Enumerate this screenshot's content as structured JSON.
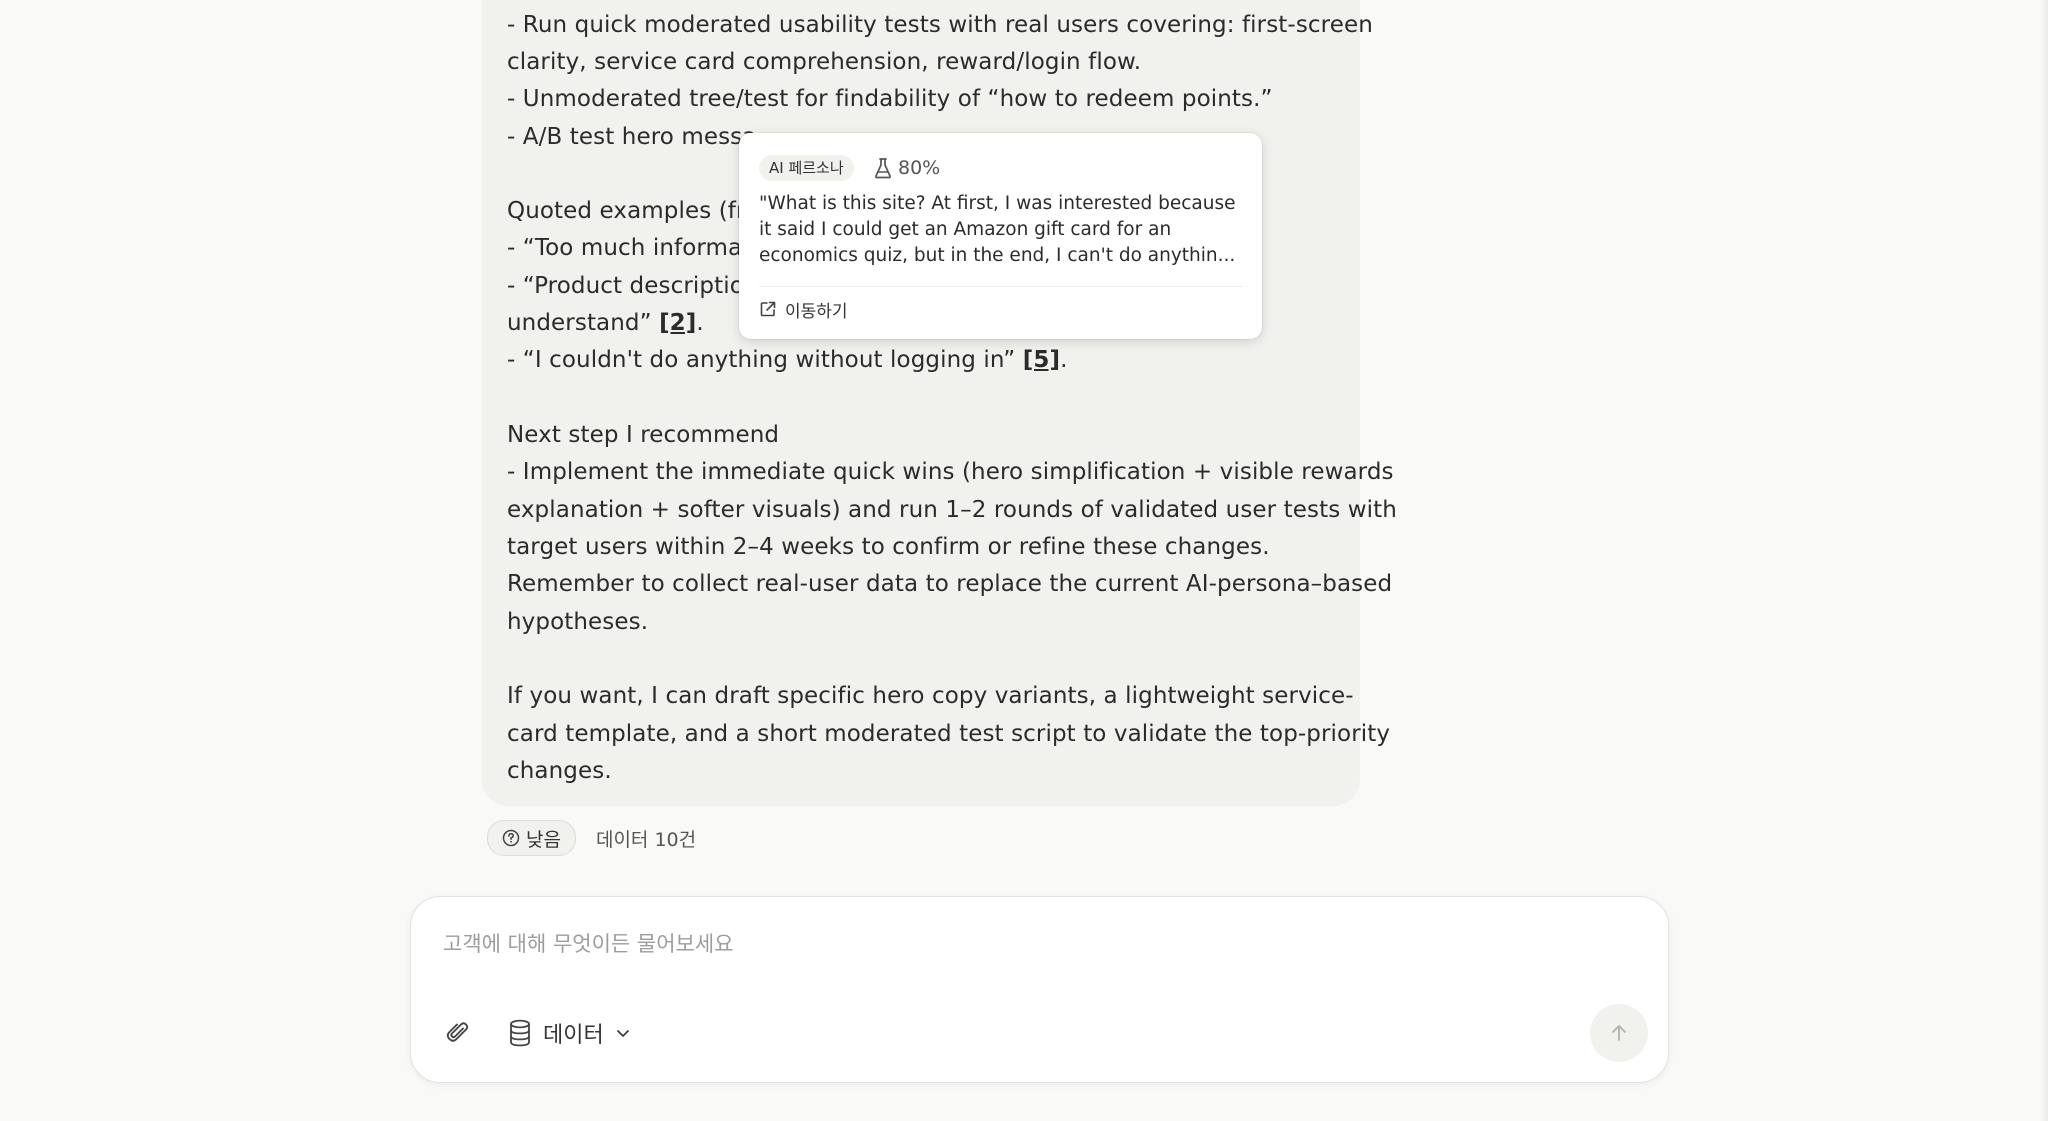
{
  "message": {
    "lines": [
      "- Run quick moderated usability tests with real users covering: first-screen",
      "clarity, service card comprehension, reward/login flow.",
      "- Unmoderated tree/test for findability of “how to redeem points.”",
      "- A/B test hero messa",
      "Quoted examples (fro",
      "- “Too much informat",
      "- “Product descriptio",
      "understand” ",
      "- “I couldn't do anything without logging in” ",
      "Next step I recommend",
      "- Implement the immediate quick wins (hero simplification + visible rewards",
      "explanation + softer visuals) and run 1–2 rounds of validated user tests with",
      "target users within 2–4 weeks to confirm or refine these changes.",
      "Remember to collect real-user data to replace the current AI-persona–based",
      "hypotheses.",
      "If you want, I can draft specific hero copy variants, a lightweight service-",
      "card template, and a short moderated test script to validate the top-priority",
      "changes."
    ],
    "refs": [
      "[2]",
      "[5]"
    ],
    "period": "."
  },
  "tooltip": {
    "badge": "AI 페르소나",
    "confidence": "80%",
    "quote": "\"What is this site? At first, I was interested because it said I could get an Amazon gift card for an economics quiz, but in the end, I can't do anythin...",
    "goto_label": "이동하기"
  },
  "status": {
    "confidence_label": "낮음",
    "data_count": "데이터 10건"
  },
  "composer": {
    "placeholder": "고객에 대해 무엇이든 물어보세요",
    "data_label": "데이터"
  },
  "icons": {
    "flask": "flask-icon",
    "external_link": "external-link-icon",
    "question": "question-circle-icon",
    "paperclip": "paperclip-icon",
    "database": "database-icon",
    "chevron": "chevron-down-icon",
    "send": "arrow-up-icon"
  }
}
